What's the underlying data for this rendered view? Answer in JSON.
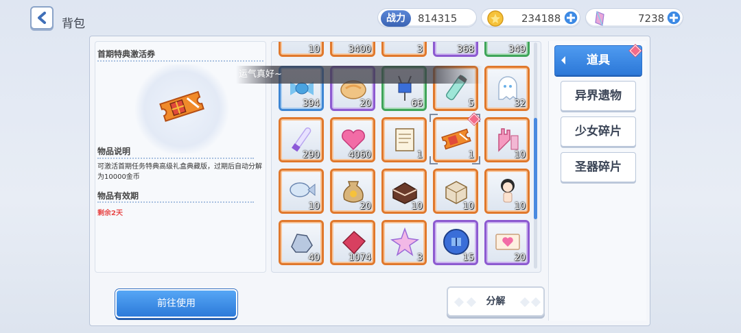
{
  "header": {
    "title": "背包"
  },
  "stats": {
    "power_label": "战力",
    "power": "814315",
    "gold": "234188",
    "gems": "7238"
  },
  "toast": "运气真好~",
  "detail": {
    "item_name": "首期特典激活券",
    "desc_title": "物品说明",
    "desc": "可激活首期任务特典高级礼盒典藏版，过期后自动分解为10000金币",
    "validity_title": "物品有效期",
    "validity": "剩余2天"
  },
  "grid": {
    "top_counts": [
      "10",
      "3400",
      "3",
      "368",
      "349"
    ],
    "rows": [
      [
        {
          "icon": "candy-icon",
          "count": "394",
          "rarity": "blue"
        },
        {
          "icon": "bread-icon",
          "count": "20",
          "rarity": "purple"
        },
        {
          "icon": "usb-icon",
          "count": "66",
          "rarity": "green"
        },
        {
          "icon": "tube-icon",
          "count": "5",
          "rarity": "orange"
        },
        {
          "icon": "ghost-icon",
          "count": "32",
          "rarity": "orange"
        }
      ],
      [
        {
          "icon": "glowstick-icon",
          "count": "290",
          "rarity": "orange"
        },
        {
          "icon": "hearts-icon",
          "count": "4060",
          "rarity": "orange"
        },
        {
          "icon": "clipboard-icon",
          "count": "1",
          "rarity": "orange"
        },
        {
          "icon": "ticket-icon",
          "count": "1",
          "rarity": "orange",
          "selected": true
        },
        {
          "icon": "foam-hand-icon",
          "count": "10",
          "rarity": "orange"
        }
      ],
      [
        {
          "icon": "fish-icon",
          "count": "10",
          "rarity": "orange"
        },
        {
          "icon": "coin-bag-icon",
          "count": "20",
          "rarity": "orange"
        },
        {
          "icon": "cake-icon",
          "count": "10",
          "rarity": "orange"
        },
        {
          "icon": "box-icon",
          "count": "10",
          "rarity": "orange"
        },
        {
          "icon": "doll-icon",
          "count": "10",
          "rarity": "orange"
        }
      ],
      [
        {
          "icon": "gloves-icon",
          "count": "40",
          "rarity": "orange"
        },
        {
          "icon": "cloth-icon",
          "count": "1074",
          "rarity": "orange"
        },
        {
          "icon": "star-crystal-icon",
          "count": "3",
          "rarity": "orange"
        },
        {
          "icon": "gift-medal-icon",
          "count": "15",
          "rarity": "purple"
        },
        {
          "icon": "heart-ticket-icon",
          "count": "20",
          "rarity": "purple"
        }
      ]
    ]
  },
  "tabs": [
    {
      "label": "道具",
      "active": true
    },
    {
      "label": "异界遗物"
    },
    {
      "label": "少女碎片"
    },
    {
      "label": "圣器碎片"
    }
  ],
  "buttons": {
    "use": "前往使用",
    "decompose": "分解"
  },
  "colors": {
    "accent": "#2c7ad9",
    "rarity_orange": "#e0782c",
    "rarity_purple": "#8c5ad0",
    "rarity_blue": "#3d86d4",
    "rarity_green": "#3fa45a",
    "expire": "#e84a4a"
  }
}
